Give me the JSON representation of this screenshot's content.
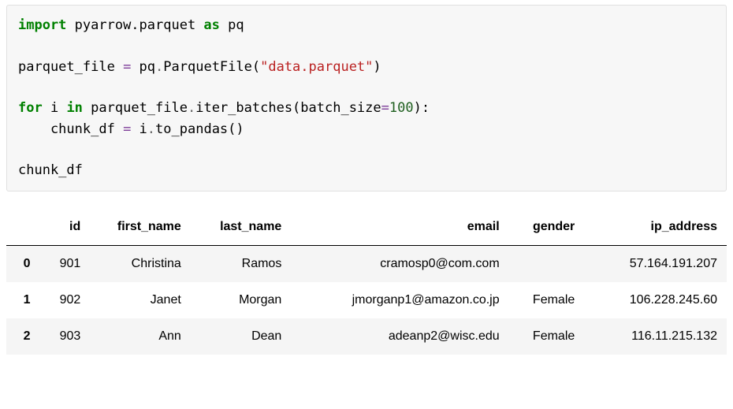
{
  "code": {
    "import_kw": "import",
    "import_mod": " pyarrow.parquet ",
    "as_kw": "as",
    "as_alias": " pq",
    "assign_line_left": "parquet_file ",
    "assign_eq": "=",
    "assign_line_right1": " pq",
    "assign_dot": ".",
    "assign_call": "ParquetFile(",
    "assign_str": "\"data.parquet\"",
    "assign_close": ")",
    "for_kw": "for",
    "for_var": " i ",
    "in_kw": "in",
    "for_iter1": " parquet_file",
    "for_dot": ".",
    "for_iter2": "iter_batches(batch_size",
    "for_eq": "=",
    "for_num": "100",
    "for_close": "):",
    "body_indent": "    chunk_df ",
    "body_eq": "=",
    "body_rhs": " i",
    "body_dot": ".",
    "body_call": "to_pandas()",
    "last_line": "chunk_df"
  },
  "table": {
    "columns": [
      "",
      "id",
      "first_name",
      "last_name",
      "email",
      "gender",
      "ip_address"
    ],
    "rows": [
      {
        "index": "0",
        "id": "901",
        "first_name": "Christina",
        "last_name": "Ramos",
        "email": "cramosp0@com.com",
        "gender": "",
        "ip_address": "57.164.191.207"
      },
      {
        "index": "1",
        "id": "902",
        "first_name": "Janet",
        "last_name": "Morgan",
        "email": "jmorganp1@amazon.co.jp",
        "gender": "Female",
        "ip_address": "106.228.245.60"
      },
      {
        "index": "2",
        "id": "903",
        "first_name": "Ann",
        "last_name": "Dean",
        "email": "adeanp2@wisc.edu",
        "gender": "Female",
        "ip_address": "116.11.215.132"
      }
    ]
  }
}
